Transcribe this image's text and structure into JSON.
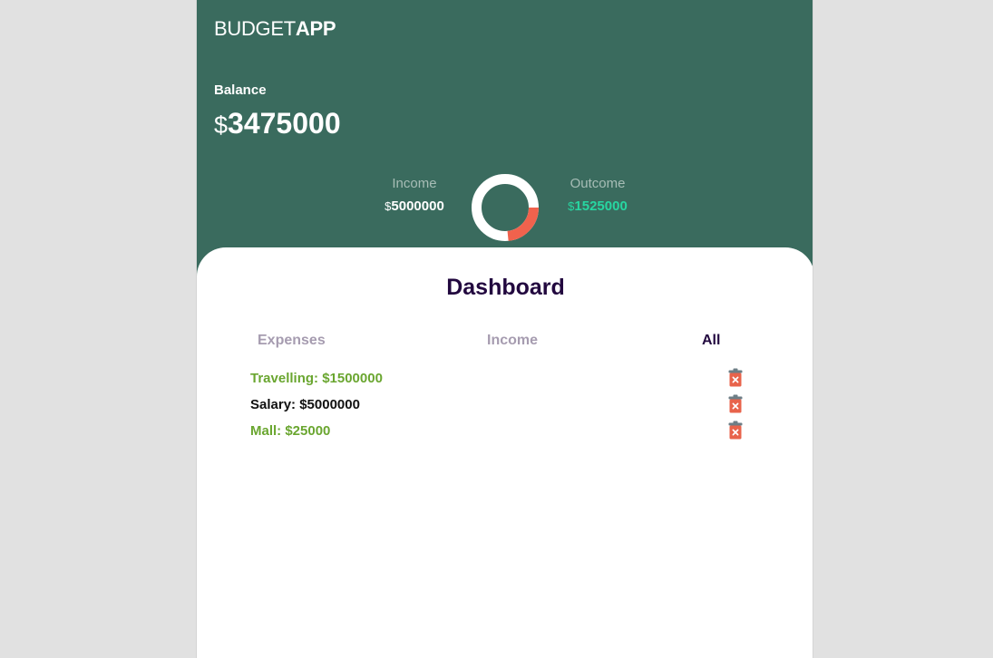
{
  "header": {
    "brand_light": "BUDGET",
    "brand_bold": "APP",
    "balance_label": "Balance",
    "balance_currency": "$",
    "balance_value": "3475000"
  },
  "summary": {
    "income_label": "Income",
    "income_currency": "$",
    "income_value": "5000000",
    "outcome_label": "Outcome",
    "outcome_currency": "$",
    "outcome_value": "1525000",
    "outcome_share": 0.2337
  },
  "dashboard": {
    "title": "Dashboard",
    "tabs": [
      {
        "label": "Expenses",
        "active": false
      },
      {
        "label": "Income",
        "active": false
      },
      {
        "label": "All",
        "active": true
      }
    ],
    "entries": [
      {
        "text": "Travelling: $1500000",
        "type": "expense",
        "icon": "trash-icon"
      },
      {
        "text": "Salary: $5000000",
        "type": "income",
        "icon": "trash-icon"
      },
      {
        "text": "Mall: $25000",
        "type": "expense",
        "icon": "trash-icon"
      }
    ]
  },
  "colors": {
    "header_bg": "#3a6b5e",
    "income_ring": "#ffffff",
    "outcome_ring": "#f0624d",
    "outcome_value": "#27d6a1",
    "expense_text": "#6aa630",
    "title_text": "#22083f"
  }
}
